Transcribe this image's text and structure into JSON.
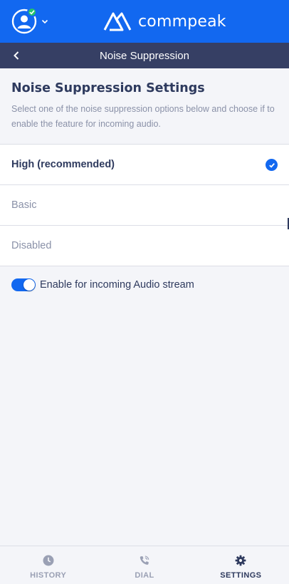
{
  "app": {
    "brand_name": "commpeak",
    "brand_color": "#1268f0",
    "status_color": "#25c26a"
  },
  "titlebar": {
    "title": "Noise Suppression",
    "back_icon": "chevron-left-icon"
  },
  "intro": {
    "heading": "Noise Suppression Settings",
    "description": "Select one of the noise suppression options below and choose if to enable the feature for incoming audio."
  },
  "options": [
    {
      "label": "High (recommended)",
      "selected": true
    },
    {
      "label": "Basic",
      "selected": false
    },
    {
      "label": "Disabled",
      "selected": false
    }
  ],
  "incoming_toggle": {
    "label": "Enable for incoming Audio stream",
    "enabled": true
  },
  "bottom_nav": [
    {
      "label": "HISTORY",
      "icon": "clock-icon",
      "active": false
    },
    {
      "label": "DIAL",
      "icon": "phone-icon",
      "active": false
    },
    {
      "label": "SETTINGS",
      "icon": "gear-icon",
      "active": true
    }
  ]
}
